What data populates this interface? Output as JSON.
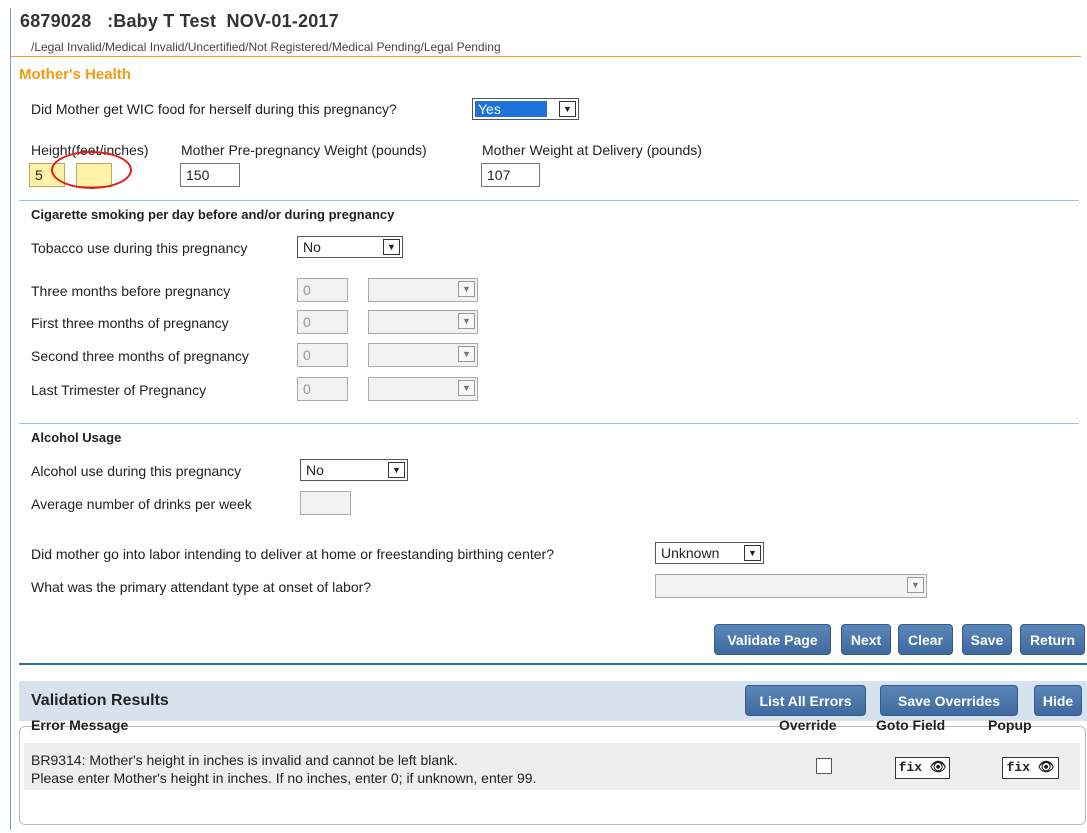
{
  "header": {
    "title": "6879028   :Baby T Test  NOV-01-2017",
    "status": "/Legal Invalid/Medical Invalid/Uncertified/Not Registered/Medical Pending/Legal Pending"
  },
  "section_title": "Mother's Health",
  "wic": {
    "label": "Did Mother get WIC food for herself during this pregnancy?",
    "value": "Yes"
  },
  "measurements": {
    "height_label": "Height(feet/inches)",
    "height_feet": "5",
    "height_inches": "",
    "pre_weight_label": "Mother Pre-pregnancy Weight (pounds)",
    "pre_weight": "150",
    "delivery_weight_label": "Mother Weight at Delivery (pounds)",
    "delivery_weight": "107"
  },
  "smoking": {
    "heading": "Cigarette smoking per day before and/or during pregnancy",
    "tobacco_label": "Tobacco use during this pregnancy",
    "tobacco_value": "No",
    "rows": [
      {
        "label": "Three months before pregnancy",
        "value": "0"
      },
      {
        "label": "First three months of pregnancy",
        "value": "0"
      },
      {
        "label": "Second three months of pregnancy",
        "value": "0"
      },
      {
        "label": "Last Trimester of Pregnancy",
        "value": "0"
      }
    ]
  },
  "alcohol": {
    "heading": "Alcohol Usage",
    "use_label": "Alcohol use during this pregnancy",
    "use_value": "No",
    "drinks_label": "Average number of drinks per week",
    "drinks_value": ""
  },
  "labor": {
    "home_label": "Did mother go into labor intending to deliver at home or freestanding birthing center?",
    "home_value": "Unknown",
    "attendant_label": "What was the primary attendant type at onset of labor?",
    "attendant_value": ""
  },
  "buttons": {
    "validate": "Validate Page",
    "next": "Next",
    "clear": "Clear",
    "save": "Save",
    "return": "Return"
  },
  "validation": {
    "title": "Validation Results",
    "list_all": "List All Errors",
    "save_overrides": "Save Overrides",
    "hide": "Hide",
    "columns": [
      "Error Message",
      "Override",
      "Goto Field",
      "Popup"
    ],
    "error_line1": "BR9314:  Mother's height in inches is invalid and cannot be left blank.",
    "error_line2": "Please enter Mother's height in inches. If no inches, enter 0; if unknown, enter 99.",
    "fix_label": "fix"
  },
  "icons": {
    "binoculars": "binoculars-icon",
    "dropdown": "chevron-down-icon"
  },
  "colors": {
    "accent_orange": "#f39c12",
    "button_blue": "#4a76ab",
    "highlight_yellow": "#fff2a8",
    "annotation_red": "#e21b1b"
  }
}
